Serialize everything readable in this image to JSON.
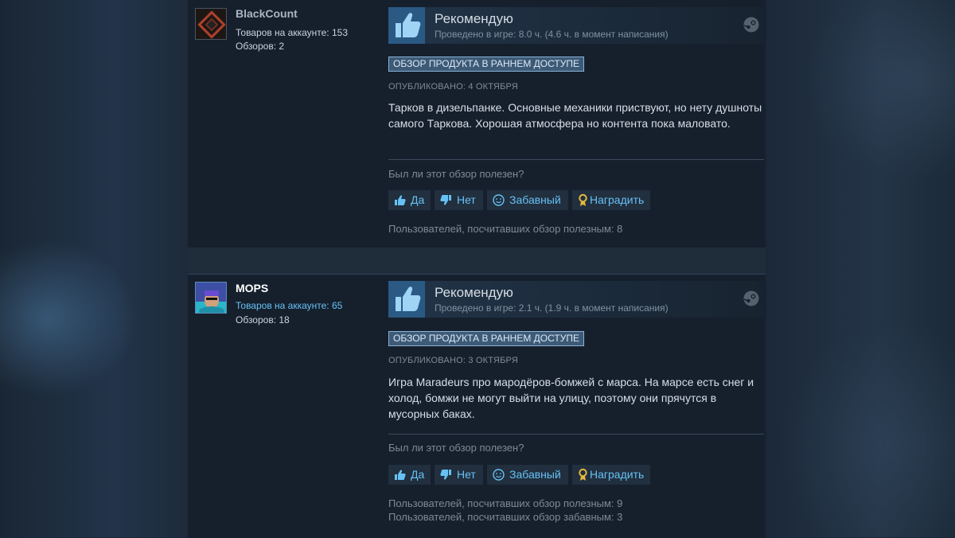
{
  "colors": {
    "page_bg": "#1b2838",
    "panel_bg": "#16202d",
    "accent_blue": "#67c1f5",
    "thumb_box": "#2a5a84",
    "award_gold": "#e3b93d"
  },
  "reviews": [
    {
      "username": "BlackCount",
      "products_label": "Товаров на аккаунте: 153",
      "reviews_label": "Обзоров: 2",
      "recommendation": "Рекомендую",
      "hours": "Проведено в игре: 8.0 ч. (4.6 ч. в момент написания)",
      "early_access_badge": "ОБЗОР ПРОДУКТА В РАННЕМ ДОСТУПЕ",
      "posted": "ОПУБЛИКОВАНО: 4 ОКТЯБРЯ",
      "text": "Тарков в дизельпанке. Основные механики приствуют, но нету душноты самого Таркова. Хорошая атмосфера но контента пока маловато.",
      "helpful_question": "Был ли этот обзор полезен?",
      "buttons": {
        "yes": "Да",
        "no": "Нет",
        "funny": "Забавный",
        "award": "Наградить"
      },
      "footer": [
        "Пользователей, посчитавших обзор полезным: 8"
      ],
      "icons": [
        "avatar-image",
        "thumbs-up-icon",
        "steam-icon",
        "thumbs-up-icon",
        "thumbs-down-icon",
        "smiley-icon",
        "award-icon"
      ]
    },
    {
      "username": "MOPS",
      "products_label": "Товаров на аккаунте: 65",
      "reviews_label": "Обзоров: 18",
      "recommendation": "Рекомендую",
      "hours": "Проведено в игре: 2.1 ч. (1.9 ч. в момент написания)",
      "early_access_badge": "ОБЗОР ПРОДУКТА В РАННЕМ ДОСТУПЕ",
      "posted": "ОПУБЛИКОВАНО: 3 ОКТЯБРЯ",
      "text": "Игра Maradeurs про мародёров-бомжей с марса. На марсе есть снег и холод, бомжи не могут выйти на улицу, поэтому они прячутся в мусорных баках.",
      "helpful_question": "Был ли этот обзор полезен?",
      "buttons": {
        "yes": "Да",
        "no": "Нет",
        "funny": "Забавный",
        "award": "Наградить"
      },
      "footer": [
        "Пользователей, посчитавших обзор полезным: 9",
        "Пользователей, посчитавших обзор забавным: 3"
      ],
      "icons": [
        "avatar-image",
        "thumbs-up-icon",
        "steam-icon",
        "thumbs-up-icon",
        "thumbs-down-icon",
        "smiley-icon",
        "award-icon"
      ]
    }
  ]
}
